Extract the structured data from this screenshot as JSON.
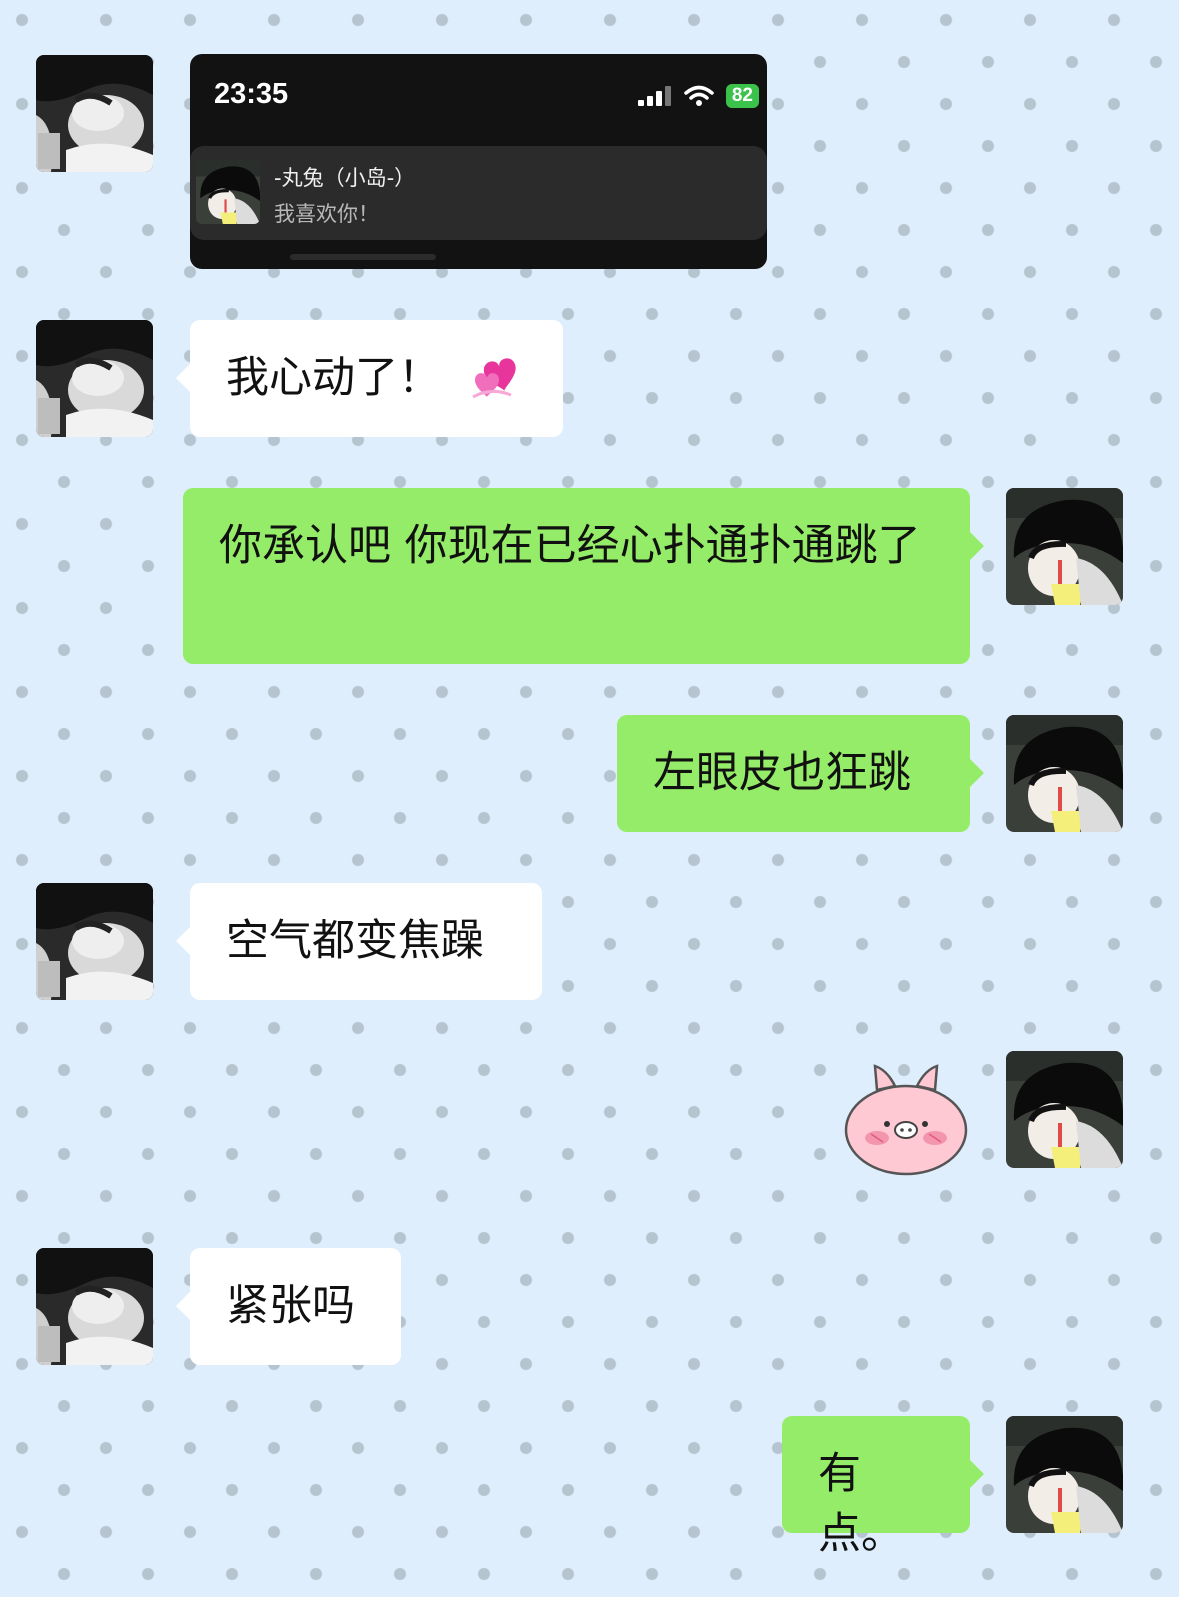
{
  "screenshot_card": {
    "time": "23:35",
    "battery": "82",
    "notification_title": "-丸兔（小岛-）",
    "notification_text": "我喜欢你！"
  },
  "messages": [
    {
      "side": "left",
      "text": "我心动了！",
      "emoji": "two-hearts-icon"
    },
    {
      "side": "right",
      "text": "你承认吧 你现在已经心扑通扑通跳了"
    },
    {
      "side": "right",
      "text": "左眼皮也狂跳"
    },
    {
      "side": "left",
      "text": "空气都变焦躁"
    },
    {
      "side": "right",
      "sticker": "blushing-pig-sticker"
    },
    {
      "side": "left",
      "text": "紧张吗"
    },
    {
      "side": "right",
      "text": "有点。"
    }
  ],
  "colors": {
    "background": "#dfeefc",
    "sent_bubble": "#95ec69",
    "received_bubble": "#ffffff",
    "battery": "#3bc24b"
  }
}
